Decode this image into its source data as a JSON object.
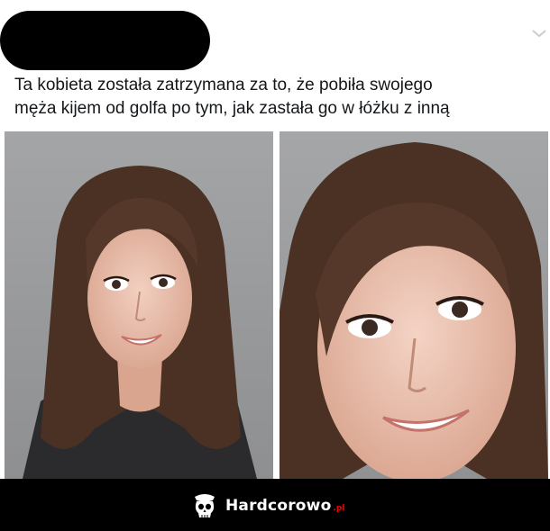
{
  "tweet": {
    "text_line_1": "Ta kobieta została zatrzymana za to, że pobiła swojego",
    "text_line_2": "męża kijem od golfa po tym, jak zastała go w łóżku z inną",
    "menu_icon": "chevron-down-icon"
  },
  "photos": [
    {
      "subject": "mugshot-photo",
      "variant": "full"
    },
    {
      "subject": "mugshot-photo",
      "variant": "close-up"
    }
  ],
  "footer": {
    "brand_name": "Hardcorowo",
    "brand_tld": ".pl",
    "logo_icon": "skull-icon"
  },
  "colors": {
    "text": "#14171a",
    "photo_background": "#9a9b9d",
    "footer_background": "#000000",
    "brand_accent": "#e10a0a"
  }
}
